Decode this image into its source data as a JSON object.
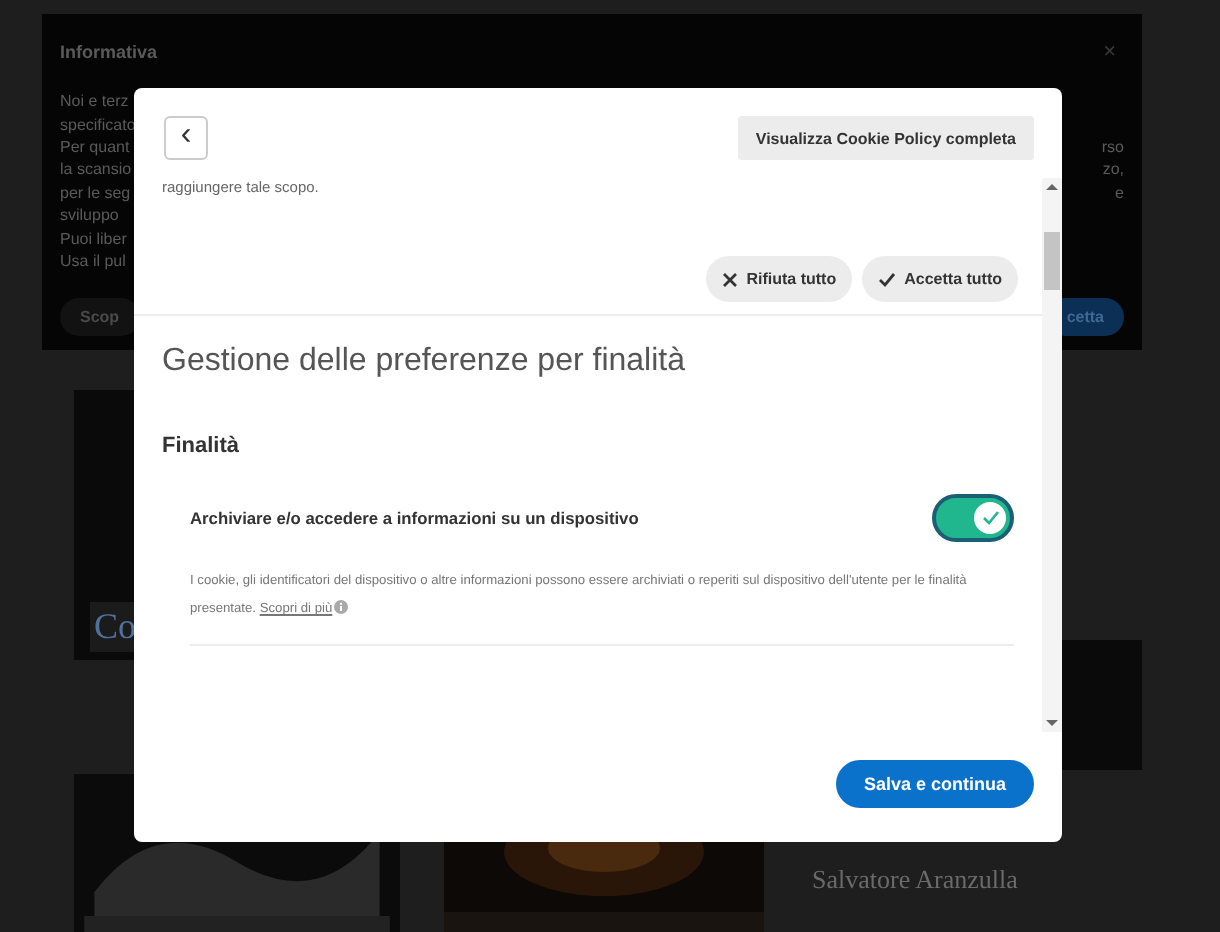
{
  "background": {
    "banner": {
      "title": "Informativa",
      "close": "×",
      "lines": [
        {
          "left": "Noi e terz"
        },
        {
          "left": "specificato"
        },
        {
          "left": "Per quant",
          "right": "rso"
        },
        {
          "left": "la scansio",
          "right": "zo,"
        },
        {
          "left": "per le seg",
          "right": "e"
        },
        {
          "left": "sviluppo"
        },
        {
          "left": "Puoi liber"
        },
        {
          "left": "Usa il pul"
        }
      ],
      "buttons": [
        {
          "label": "Scop",
          "kind": "secondary"
        },
        {
          "label": "cetta",
          "kind": "primary"
        }
      ]
    },
    "card_fragment": "Co",
    "article_author": "Salvatore Aranzulla"
  },
  "dialog": {
    "back": "‹",
    "policy_button": "Visualizza Cookie Policy completa",
    "intro_tail": "raggiungere tale scopo.",
    "actions": [
      {
        "label": "Rifiuta tutto",
        "kind": "reject"
      },
      {
        "label": "Accetta tutto",
        "kind": "accept"
      }
    ],
    "heading": "Gestione delle preferenze per finalità",
    "section": "Finalità",
    "purposes": [
      {
        "title": "Archiviare e/o accedere a informazioni su un dispositivo",
        "on": true,
        "description": "I cookie, gli identificatori del dispositivo o altre informazioni possono essere archiviati o reperiti sul dispositivo dell'utente per le finalità presentate.",
        "link": "Scopri di più"
      }
    ],
    "save_button": "Salva e continua"
  }
}
